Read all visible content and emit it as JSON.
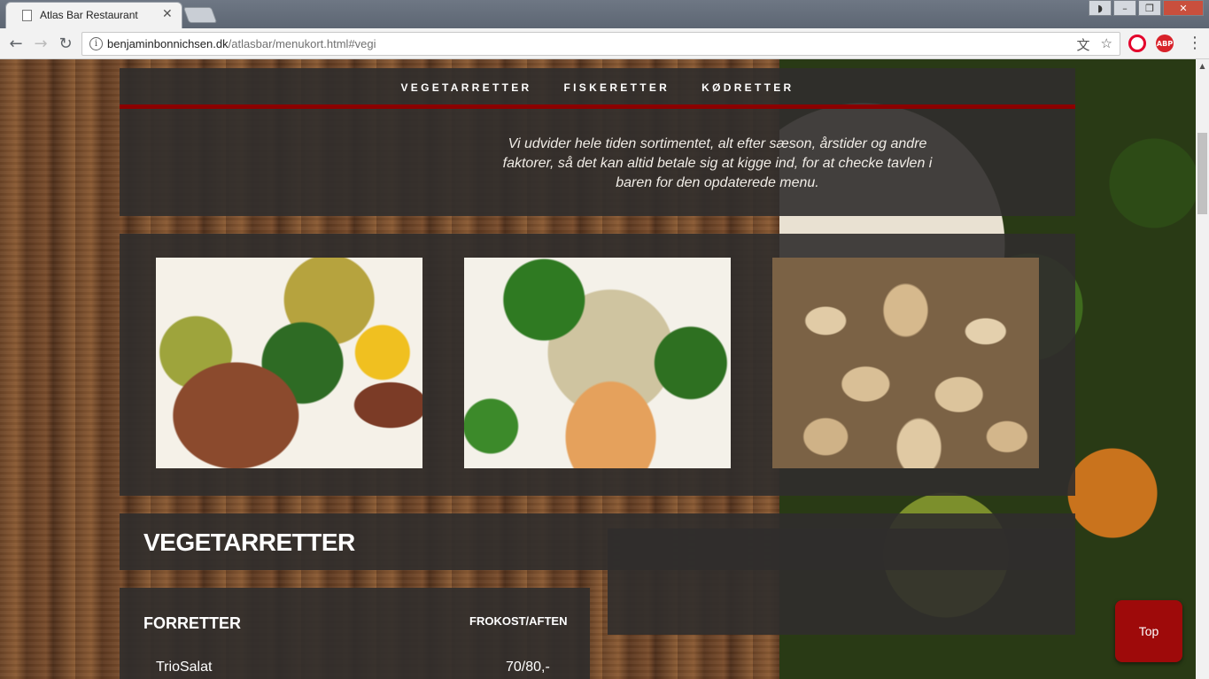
{
  "browser": {
    "tab_title": "Atlas Bar Restaurant",
    "tab_close": "✕",
    "url_host": "benjaminbonnichsen.dk",
    "url_path": "/atlasbar/menukort.html#vegi",
    "ext_opera": "",
    "ext_abp": "ABP",
    "icons": [
      "back-arrow-icon",
      "forward-arrow-icon",
      "reload-icon",
      "info-icon",
      "translate-icon",
      "star-icon",
      "opera-icon",
      "adblock-icon",
      "menu-icon"
    ]
  },
  "nav": {
    "items": [
      "VEGETARRETTER",
      "FISKERETTER",
      "KØDRETTER"
    ]
  },
  "intro": {
    "text": "Vi udvider hele tiden sortimentet, alt efter sæson, årstider og andre faktorer, så det kan altid betale sig at kigge ind, for at checke tavlen i baren for den opdaterede menu."
  },
  "section": {
    "title": "VEGETARRETTER"
  },
  "menu": {
    "course_title": "FORRETTER",
    "price_header": "FROKOST/AFTEN",
    "dishes": [
      {
        "name": "TrioSalat",
        "price": "70/80,-"
      }
    ]
  },
  "top_button": {
    "label": "Top"
  },
  "colors": {
    "accent_red": "#8b0000",
    "panel_bg": "#302d2c",
    "top_button": "#9e0a0a"
  }
}
